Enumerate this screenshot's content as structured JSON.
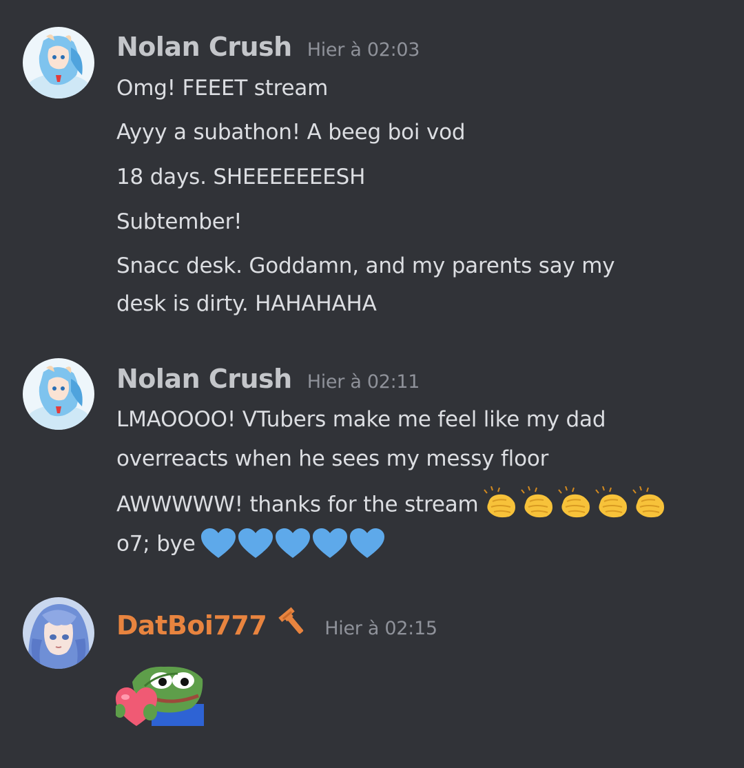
{
  "messages": [
    {
      "username": "Nolan Crush",
      "timestamp": "Hier à 02:03",
      "lines": [
        "Omg! FEEET stream",
        "Ayyy a subathon!  A beeg boi vod",
        "18 days. SHEEEEEEESH",
        "Subtember!",
        "Snacc desk. Goddamn, and my parents say  my",
        "desk is dirty. HAHAHAHA"
      ]
    },
    {
      "username": "Nolan Crush",
      "timestamp": "Hier à 02:11",
      "lines": [
        "LMAOOOO! VTubers make me feel like my dad",
        "overreacts when he sees my messy floor",
        "AWWWWW! thanks for the stream",
        "o7; bye"
      ],
      "emojis": {
        "line3": [
          "clapping-hands",
          "clapping-hands",
          "clapping-hands",
          "clapping-hands",
          "clapping-hands"
        ],
        "line4": [
          "blue-heart",
          "blue-heart",
          "blue-heart",
          "blue-heart",
          "blue-heart"
        ]
      }
    },
    {
      "username": "DatBoi777",
      "username_color": "#e8843f",
      "badge_icon": "wrench-icon",
      "timestamp": "Hier à 02:15",
      "sticker": "pepe-holding-heart-sticker"
    }
  ],
  "colors": {
    "background": "#313338",
    "username_default": "#c4c6ca",
    "username_orange": "#e8843f",
    "timestamp": "#8f929a",
    "message_text": "#dcdee2",
    "blue_heart": "#5ea9ea",
    "clap_yellow": "#f7c23a"
  }
}
